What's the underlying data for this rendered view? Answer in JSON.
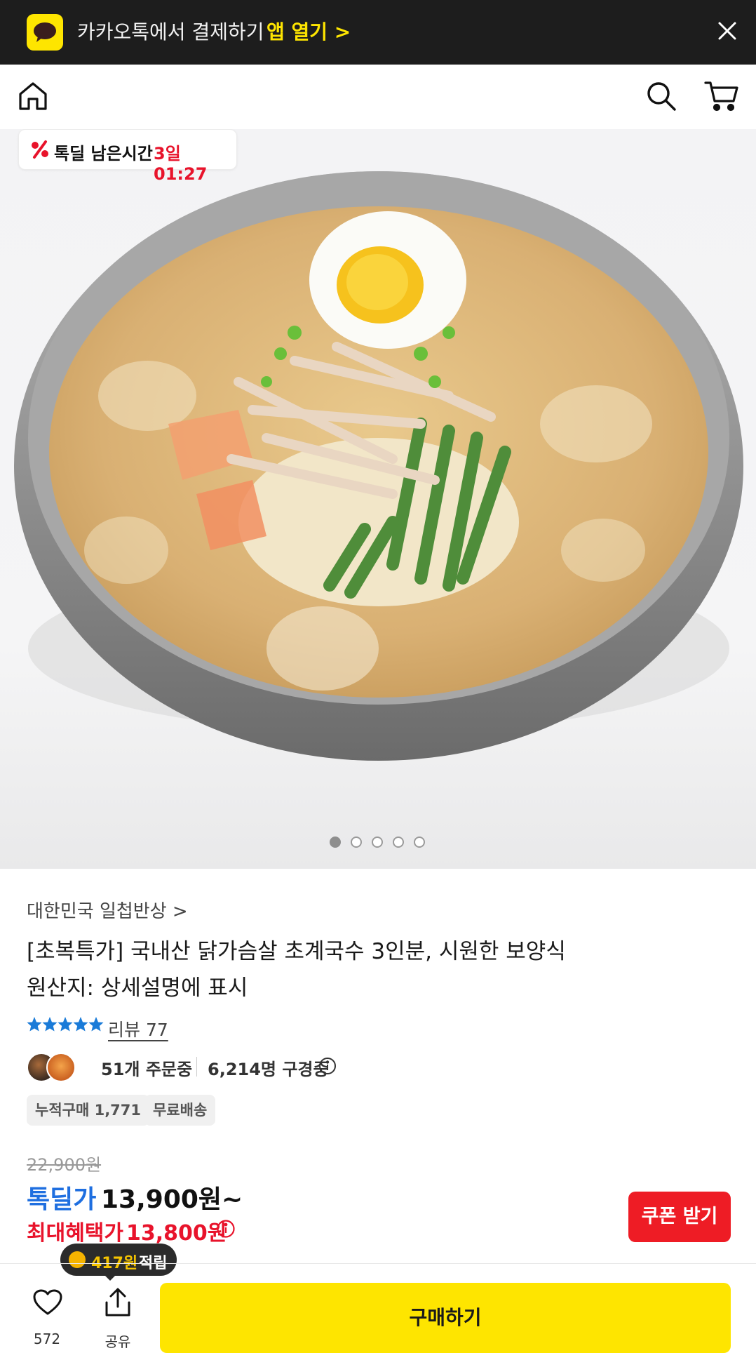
{
  "banner": {
    "text": "카카오톡에서 결제하기",
    "open_label": "앱 열기 >"
  },
  "deal_timer": {
    "label": "톡딜 남은시간",
    "time": "3일 01:27"
  },
  "carousel": {
    "count": 5,
    "active": 1
  },
  "product": {
    "seller": "대한민국 일첩반상 >",
    "title_line1": "[초복특가] 국내산 닭가슴살 초계국수 3인분, 시원한 보양식",
    "title_line2": "원산지: 상세설명에 표시",
    "rating_stars": 5,
    "review_label": "리뷰 77",
    "orders": "51개 주문중",
    "viewers": "6,214명 구경중",
    "tags": [
      "누적구매 1,771",
      "무료배송"
    ],
    "original_price": "22,900원",
    "deal_label": "톡딜가",
    "deal_price": "13,900원~",
    "max_label": "최대혜택가",
    "max_price": "13,800원"
  },
  "coupon_label": "쿠폰 받기",
  "reward": {
    "amount": "417원",
    "text": "적립"
  },
  "bottom_bar": {
    "like_count": "572",
    "share_label": "공유",
    "buy_label": "구매하기"
  },
  "colors": {
    "kakao_yellow": "#fee500",
    "deal_blue": "#1f6fe0",
    "sale_red": "#e8132b",
    "coupon_red": "#ee1c25",
    "star_blue": "#1a7bd8"
  }
}
